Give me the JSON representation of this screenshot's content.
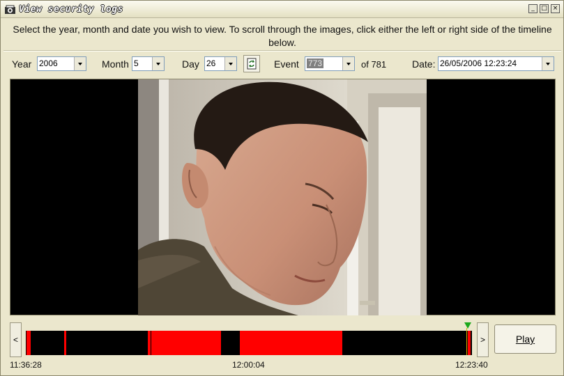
{
  "window": {
    "title": "View security logs",
    "minimize_glyph": "_",
    "maximize_glyph": "□",
    "close_glyph": "×"
  },
  "instructions": "Select the year, month and date you wish to view. To scroll through the images, click either the left or right side of the timeline below.",
  "filters": {
    "year_label": "Year",
    "year_value": "2006",
    "month_label": "Month",
    "month_value": "5",
    "day_label": "Day",
    "day_value": "26",
    "event_label": "Event",
    "event_value": "773",
    "event_total": "of 781",
    "date_label": "Date:",
    "date_value": "26/05/2006 12:23:24"
  },
  "timeline": {
    "prev_label": "<",
    "next_label": ">",
    "start_time": "11:36:28",
    "mid_time": "12:00:04",
    "end_time": "12:23:40"
  },
  "play_label": "Play",
  "colors": {
    "event_segment": "#ff0000",
    "timeline_bg": "#000000",
    "cursor_marker": "#1ca81c"
  },
  "icons": {
    "app": "camera-icon",
    "refresh": "refresh-icon",
    "dropdown": "chevron-down-icon"
  }
}
